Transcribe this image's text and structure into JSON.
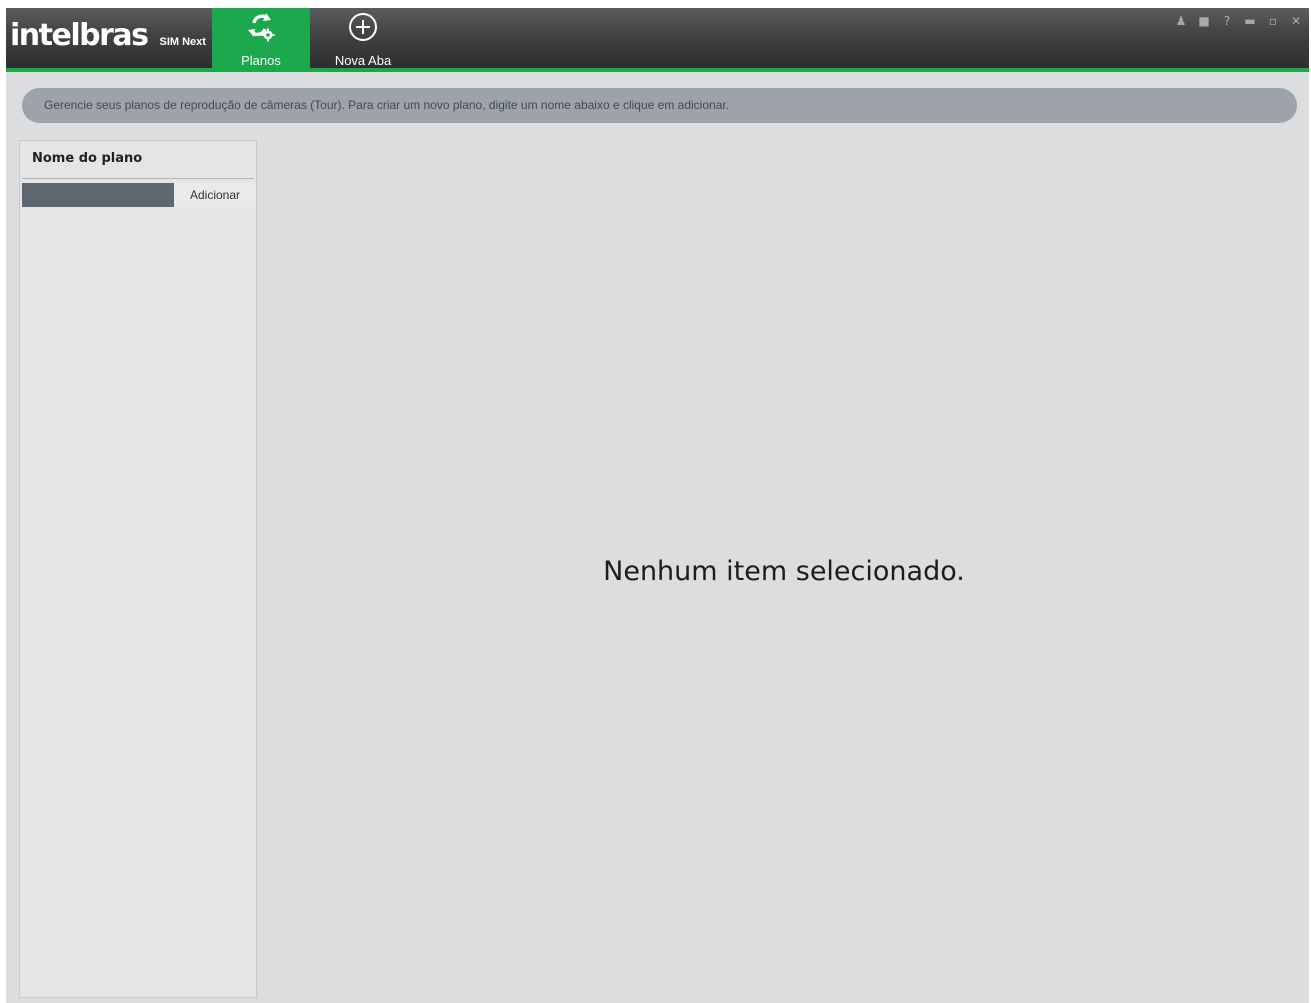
{
  "brand": {
    "name": "intelbras",
    "product": "SIM Next"
  },
  "tabs": [
    {
      "label": "Planos",
      "icon": "plans-refresh-gear-icon",
      "active": true
    },
    {
      "label": "Nova Aba",
      "icon": "add-circle-icon",
      "active": false
    }
  ],
  "window_controls": [
    "user-icon",
    "lock-icon",
    "help-icon",
    "minimize-icon",
    "restore-icon",
    "close-icon"
  ],
  "banner": {
    "text": "Gerencie seus planos de reprodução de câmeras (Tour). Para criar um novo plano, digite um nome abaixo e clique em adicionar."
  },
  "plans_panel": {
    "header": "Nome do plano",
    "input_value": "",
    "add_label": "Adicionar"
  },
  "main": {
    "empty_message": "Nenhum item selecionado."
  },
  "colors": {
    "accent_green": "#1ea84d",
    "titlebar_dark": "#2b2d2f",
    "banner_bg": "#9ea3aa",
    "input_bg": "#5e676f",
    "background": "#dcdddf"
  }
}
